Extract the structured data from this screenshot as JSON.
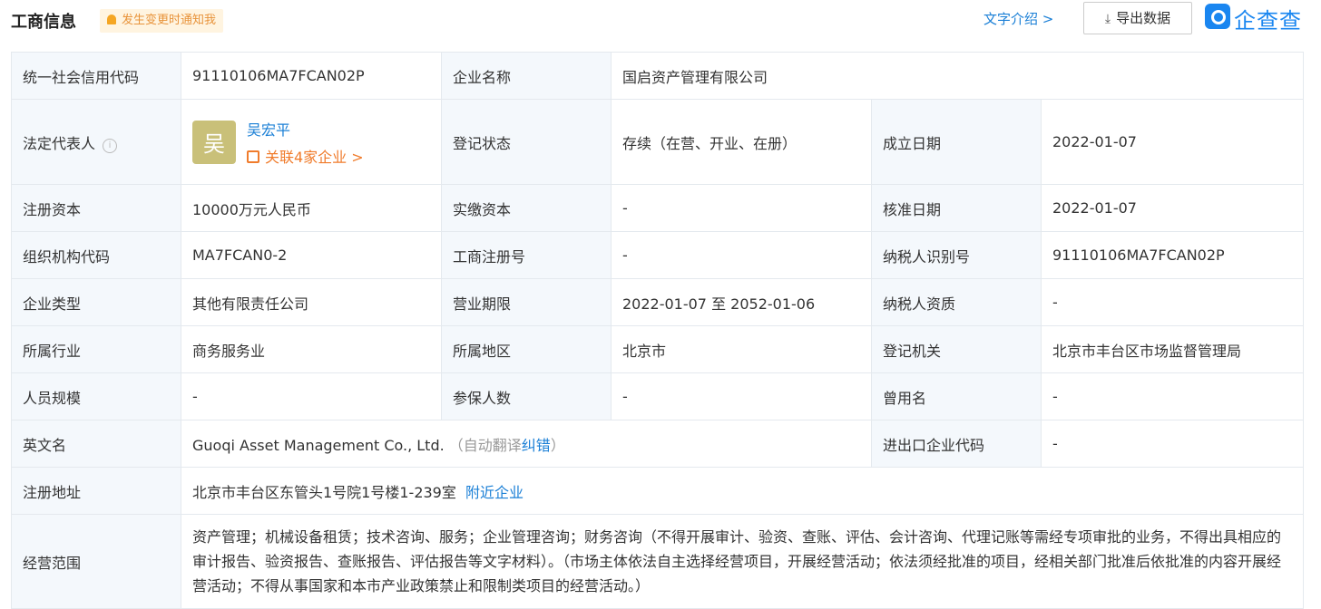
{
  "header": {
    "title": "工商信息",
    "notify_label": "发生变更时通知我",
    "text_intro": "文字介绍 >",
    "export_label": "导出数据",
    "export_icon": "download-icon",
    "logo_text": "企查查"
  },
  "rows": {
    "r1": {
      "uscc_label": "统一社会信用代码",
      "uscc": "91110106MA7FCAN02P",
      "name_label": "企业名称",
      "name": "国启资产管理有限公司"
    },
    "r2": {
      "rep_label": "法定代表人",
      "avatar_char": "吴",
      "rep_name": "吴宏平",
      "rep_link": "关联4家企业 >",
      "status_label": "登记状态",
      "status": "存续（在营、开业、在册）",
      "est_label": "成立日期",
      "est_date": "2022-01-07"
    },
    "r3": {
      "capital_label": "注册资本",
      "capital": "10000万元人民币",
      "paid_label": "实缴资本",
      "paid": "-",
      "approve_label": "核准日期",
      "approve": "2022-01-07"
    },
    "r4": {
      "org_label": "组织机构代码",
      "org": "MA7FCAN0-2",
      "reg_label": "工商注册号",
      "reg": "-",
      "taxid_label": "纳税人识别号",
      "taxid": "91110106MA7FCAN02P"
    },
    "r5": {
      "type_label": "企业类型",
      "type": "其他有限责任公司",
      "period_label": "营业期限",
      "period": "2022-01-07 至 2052-01-06",
      "taxq_label": "纳税人资质",
      "taxq": "-"
    },
    "r6": {
      "industry_label": "所属行业",
      "industry": "商务服务业",
      "region_label": "所属地区",
      "region": "北京市",
      "authority_label": "登记机关",
      "authority": "北京市丰台区市场监督管理局"
    },
    "r7": {
      "staff_label": "人员规模",
      "staff": "-",
      "insured_label": "参保人数",
      "insured": "-",
      "former_label": "曾用名",
      "former": "-"
    },
    "r8": {
      "en_label": "英文名",
      "en_name": "Guoqi Asset Management Co., Ltd.",
      "auto_pre": "（自动翻译",
      "correct": "纠错",
      "auto_post": "）",
      "ie_label": "进出口企业代码",
      "ie": "-"
    },
    "r9": {
      "addr_label": "注册地址",
      "addr": "北京市丰台区东管头1号院1号楼1-239室",
      "nearby": "附近企业"
    },
    "r10": {
      "scope_label": "经营范围",
      "scope": "资产管理；机械设备租赁；技术咨询、服务；企业管理咨询；财务咨询（不得开展审计、验资、查账、评估、会计咨询、代理记账等需经专项审批的业务，不得出具相应的审计报告、验资报告、查账报告、评估报告等文字材料）。（市场主体依法自主选择经营项目，开展经营活动；依法须经批准的项目，经相关部门批准后依批准的内容开展经营活动；不得从事国家和本市产业政策禁止和限制类项目的经营活动。）"
    }
  },
  "colors": {
    "link": "#1a7fd6",
    "label_bg": "#f4f8fc",
    "border": "#e4e9ee",
    "orange": "#f07c2c",
    "avatar_bg": "#c9c079"
  }
}
